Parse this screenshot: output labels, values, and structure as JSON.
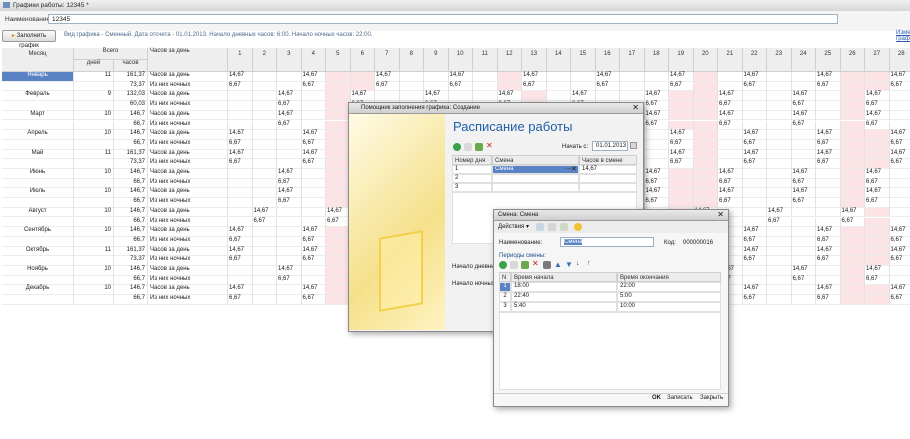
{
  "window": {
    "title": "Графики работы: 12345 *"
  },
  "form": {
    "name_label": "Наименование:",
    "name_value": "12345",
    "fill_button": "Заполнить график",
    "info": "Вид графика - Сменный. Дата отсчета - 01.01.2013. Начало дневных часов: 6:00. Начало ночных часов: 22:00.",
    "link": "Изме графи"
  },
  "grid": {
    "col_month": "Месяц",
    "col_total": "Всего",
    "col_days": "дней",
    "col_hours": "часов",
    "col_type": "Часов за день",
    "day_cols": [
      "1",
      "2",
      "3",
      "4",
      "5",
      "6",
      "7",
      "8",
      "9",
      "10",
      "11",
      "12",
      "13",
      "14",
      "15",
      "16",
      "17",
      "18",
      "19",
      "20",
      "21",
      "22",
      "23",
      "24",
      "25",
      "26",
      "27",
      "28"
    ],
    "type_day": "Часов за день",
    "type_night": "Из них ночных",
    "val_day": "14,67",
    "val_night": "6,67",
    "months": [
      {
        "name": "Январь",
        "days": "11",
        "hours": "161,37",
        "night": "73,37"
      },
      {
        "name": "Февраль",
        "days": "9",
        "hours": "132,03",
        "night": "60,03"
      },
      {
        "name": "Март",
        "days": "10",
        "hours": "146,7",
        "night": "66,7"
      },
      {
        "name": "Апрель",
        "days": "10",
        "hours": "146,7",
        "night": "66,7"
      },
      {
        "name": "Май",
        "days": "11",
        "hours": "161,37",
        "night": "73,37"
      },
      {
        "name": "Июнь",
        "days": "10",
        "hours": "146,7",
        "night": "66,7"
      },
      {
        "name": "Июль",
        "days": "10",
        "hours": "146,7",
        "night": "66,7"
      },
      {
        "name": "Август",
        "days": "10",
        "hours": "146,7",
        "night": "66,7"
      },
      {
        "name": "Сентябрь",
        "days": "10",
        "hours": "146,7",
        "night": "66,7"
      },
      {
        "name": "Октябрь",
        "days": "11",
        "hours": "161,37",
        "night": "73,37"
      },
      {
        "name": "Ноябрь",
        "days": "10",
        "hours": "146,7",
        "night": "66,7"
      },
      {
        "name": "Декабрь",
        "days": "10",
        "hours": "146,7",
        "night": "66,7"
      }
    ]
  },
  "dialog1": {
    "title": "Помощник заполнения графика: Создание",
    "heading": "Расписание работы",
    "start_label": "Начать с:",
    "start_value": "01.01.2013",
    "col_num": "Номер дня",
    "col_shift": "Смена",
    "col_hours": "Часов в смене",
    "rows": [
      {
        "n": "1",
        "shift": "Смена",
        "hours": "14,67"
      },
      {
        "n": "2",
        "shift": "",
        "hours": ""
      },
      {
        "n": "3",
        "shift": "",
        "hours": ""
      }
    ],
    "day_start_label": "Начало дневны",
    "night_start_label": "Начало ночных"
  },
  "dialog2": {
    "title": "Смена: Смена",
    "actions": "Действия ▾",
    "name_label": "Наименование:",
    "name_value": "Смена",
    "code_label": "Код:",
    "code_value": "000000016",
    "periods_label": "Периоды смены:",
    "col_n": "N",
    "col_start": "Время начала",
    "col_end": "Время окончания",
    "rows": [
      {
        "n": "1",
        "start": "18:00",
        "end": "22:00"
      },
      {
        "n": "2",
        "start": "22:40",
        "end": "5:00"
      },
      {
        "n": "3",
        "start": "5:40",
        "end": "10:00"
      }
    ],
    "ok": "OK",
    "save": "Записать",
    "close": "Закрыть"
  }
}
